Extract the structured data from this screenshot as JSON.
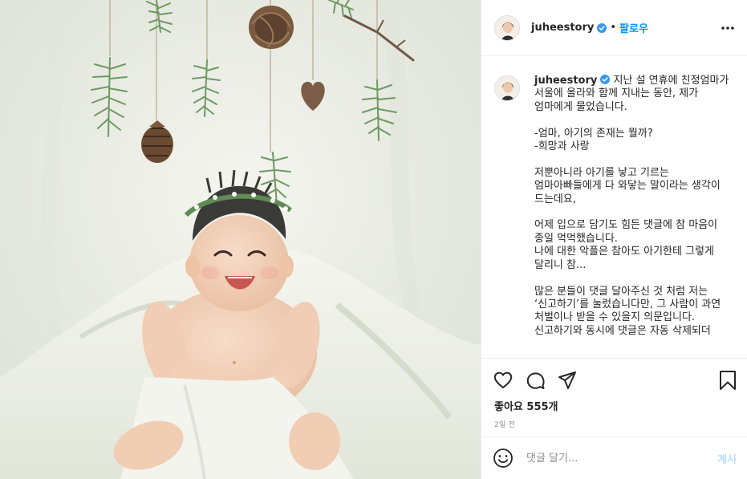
{
  "post": {
    "image": {
      "description_icon": "baby-photo"
    },
    "header": {
      "username": "juheestory",
      "separator": "•",
      "follow_label": "팔로우",
      "more_icon": "more-horizontal-icon",
      "verified_icon": "verified-badge-icon"
    },
    "caption": {
      "username": "juheestory",
      "text": "지난 설 연휴에 친정엄마가 서울에 올라와 함께 지내는 동안, 제가 엄마에게 물었습니다.\n\n-엄마, 아기의 존재는 뭘까?\n-희망과 사랑\n\n저뿐아니라 아기를 낳고 기르는 엄마아빠들에게 다 와닿는 말이라는 생각이 드는데요,\n\n어제 입으로 담기도 힘든 댓글에 참 마음이 종일 먹먹했습니다.\n나에 대한 악플은 참아도 아기한테 그렇게 달리니 참...\n\n많은 분들이 댓글 달아주신 것 처럼 저는 ‘신고하기’를 눌렀습니다만, 그 사람이 과연 처벌이나 받을 수 있을지 의문입니다.\n신고하기와 동시에 댓글은 자동 삭제되더"
    },
    "actions": {
      "like_icon": "heart-icon",
      "comment_icon": "comment-icon",
      "share_icon": "send-icon",
      "save_icon": "bookmark-icon"
    },
    "likes_label": "좋아요 555개",
    "timestamp": "2일 전",
    "comment_box": {
      "emoji_icon": "smiley-icon",
      "placeholder": "댓글 달기...",
      "post_label": "게시"
    },
    "colors": {
      "accent": "#0095f6",
      "post_disabled": "#b2dffc",
      "verified": "#3897f0",
      "border": "#efefef",
      "muted_text": "#8e8e8e"
    }
  }
}
